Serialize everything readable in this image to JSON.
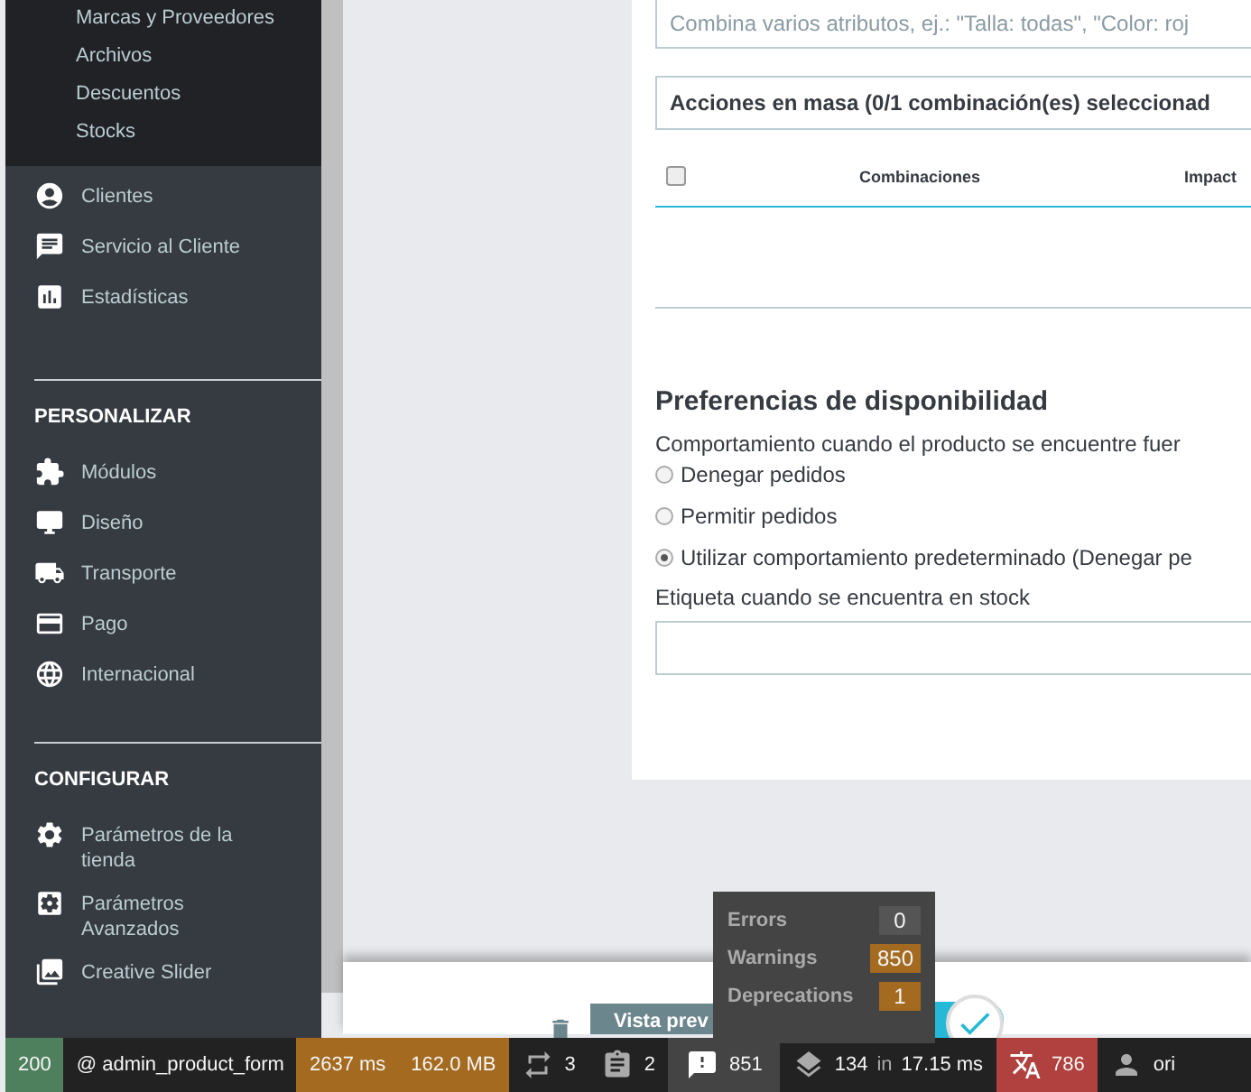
{
  "sidebar": {
    "submenu": [
      "Marcas y Proveedores",
      "Archivos",
      "Descuentos",
      "Stocks"
    ],
    "groups": [
      {
        "items": [
          "Clientes",
          "Servicio al Cliente",
          "Estadísticas"
        ]
      },
      {
        "heading": "PERSONALIZAR",
        "items": [
          "Módulos",
          "Diseño",
          "Transporte",
          "Pago",
          "Internacional"
        ]
      },
      {
        "heading": "CONFIGURAR",
        "items": [
          "Parámetros de la tienda",
          "Parámetros Avanzados",
          "Creative Slider"
        ]
      }
    ]
  },
  "combinations": {
    "placeholder": "Combina varios atributos, ej.: \"Talla: todas\", \"Color: roj",
    "bulk_actions": "Acciones en masa (0/1 combinación(es) seleccionad",
    "select_all_checked": false,
    "columns": [
      "Combinaciones",
      "Impact"
    ]
  },
  "availability": {
    "title": "Preferencias de disponibilidad",
    "behavior_label": "Comportamiento cuando el producto se encuentre fuer",
    "options": [
      {
        "label": "Denegar pedidos",
        "selected": false
      },
      {
        "label": "Permitir pedidos",
        "selected": false
      },
      {
        "label": "Utilizar comportamiento predeterminado (Denegar pe",
        "selected": true
      }
    ],
    "in_stock_label": "Etiqueta cuando se encuentra en stock"
  },
  "footer": {
    "preview_button": "Vista prev",
    "switch_on": true
  },
  "debug_popup": [
    {
      "label": "Errors",
      "count": "0",
      "color": "#555555"
    },
    {
      "label": "Warnings",
      "count": "850",
      "color": "#a46a1f"
    },
    {
      "label": "Deprecations",
      "count": "1",
      "color": "#a46a1f"
    }
  ],
  "debug_toolbar": {
    "status": "200",
    "route": "@ admin_product_form",
    "time": "2637 ms",
    "memory": "162.0 MB",
    "forms": "3",
    "logs": "2",
    "logs_info": "851",
    "queries": "134",
    "queries_in": "in",
    "queries_time": "17.15 ms",
    "translations": "786",
    "user": "ori"
  }
}
